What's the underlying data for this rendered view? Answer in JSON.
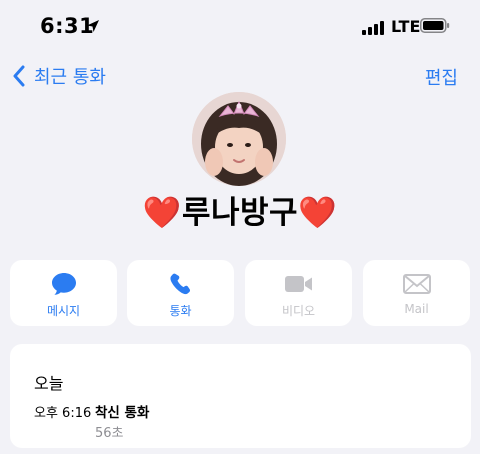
{
  "status_bar": {
    "time": "6:31",
    "network": "LTE",
    "icons": [
      "location-arrow-icon",
      "cellular-signal-icon",
      "battery-icon"
    ]
  },
  "nav": {
    "back_label": "최근 통화",
    "edit_label": "편집"
  },
  "contact": {
    "name": "❤️루나방구❤️",
    "avatar": "child-photo-avatar"
  },
  "actions": [
    {
      "label": "메시지",
      "icon": "message-bubble-icon",
      "enabled": true
    },
    {
      "label": "통화",
      "icon": "phone-icon",
      "enabled": true
    },
    {
      "label": "비디오",
      "icon": "video-camera-icon",
      "enabled": false
    },
    {
      "label": "Mail",
      "icon": "mail-envelope-icon",
      "enabled": false
    }
  ],
  "call_log": {
    "section_title": "오늘",
    "entries": [
      {
        "time": "오후 6:16",
        "type": "착신 통화",
        "duration": "56초"
      }
    ]
  },
  "colors": {
    "accent": "#2b7cf1",
    "background": "#f2f2f7",
    "card": "#ffffff",
    "disabled": "#c4c4c8",
    "secondary_text": "#8e8e93"
  }
}
